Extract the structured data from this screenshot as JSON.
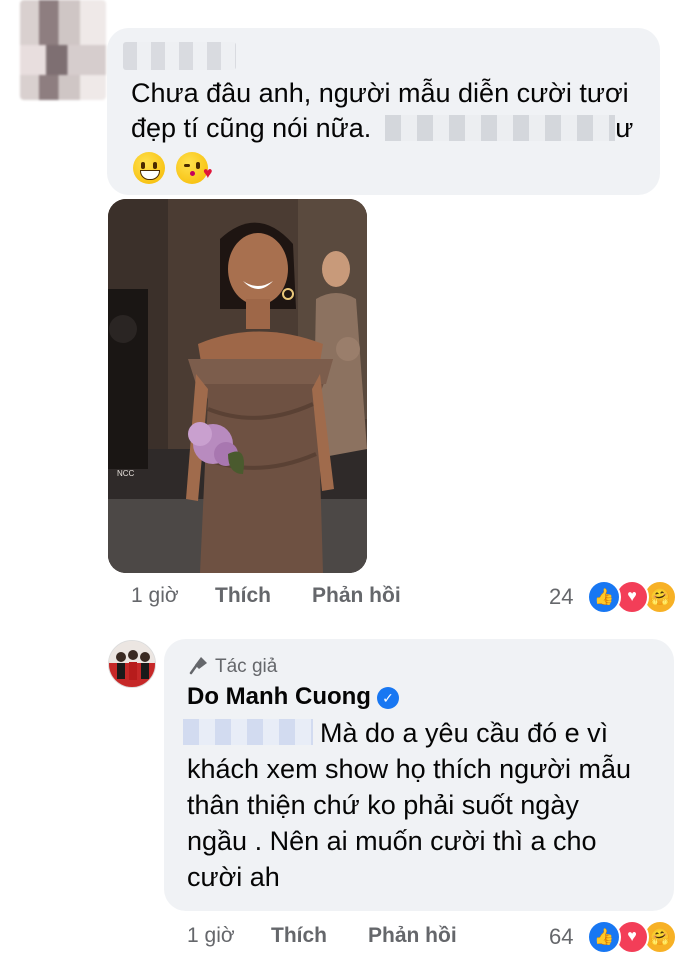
{
  "comment1": {
    "text_line1": "Chưa đâu anh, người mẫu diễn cười tươi",
    "text_line2_start": "đẹp tí cũng nói nữa.",
    "text_line2_end": "ư",
    "image_watermark": "NCC",
    "time": "1 giờ",
    "like_label": "Thích",
    "reply_label": "Phản hồi",
    "reaction_count": "24",
    "reaction_icons": [
      "like-icon",
      "love-icon",
      "care-icon"
    ]
  },
  "comment2": {
    "author_badge": "Tác giả",
    "author_name": "Do Manh Cuong",
    "text_line1": "Mà do a yêu cầu đó e vì",
    "text_line2": "khách xem show họ thích người mẫu",
    "text_line3": "thân thiện chứ ko phải suốt ngày",
    "text_line4": "ngầu . Nên ai muốn cười thì a cho",
    "text_line5": "cười ah",
    "time": "1 giờ",
    "like_label": "Thích",
    "reply_label": "Phản hồi",
    "reaction_count": "64",
    "reaction_icons": [
      "like-icon",
      "love-icon",
      "care-icon"
    ]
  },
  "colors": {
    "bubble": "#f0f2f5",
    "meta_text": "#65676b",
    "like_blue": "#1877f2",
    "love_red": "#f33e58",
    "care_yellow": "#f7b125"
  }
}
